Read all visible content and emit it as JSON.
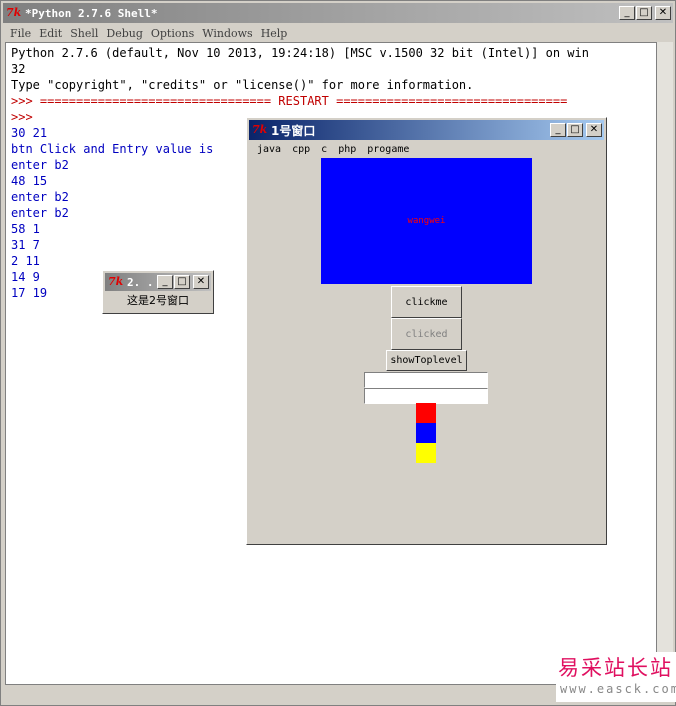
{
  "shell": {
    "title": "*Python 2.7.6 Shell*",
    "icon_text": "7k",
    "menu": [
      "File",
      "Edit",
      "Shell",
      "Debug",
      "Options",
      "Windows",
      "Help"
    ],
    "lines": [
      {
        "text": "Python 2.7.6 (default, Nov 10 2013, 19:24:18) [MSC v.1500 32 bit (Intel)] on win",
        "color": "blk"
      },
      {
        "text": "32",
        "color": "blk"
      },
      {
        "text": "Type \"copyright\", \"credits\" or \"license()\" for more information.",
        "color": "blk"
      },
      {
        "text": ">>> ================================ RESTART ================================",
        "color": "red"
      },
      {
        "text": ">>> ",
        "color": "red"
      },
      {
        "text": "30 21",
        "color": "blu"
      },
      {
        "text": "btn Click and Entry value is",
        "color": "blu"
      },
      {
        "text": "enter b2",
        "color": "blu"
      },
      {
        "text": "48 15",
        "color": "blu"
      },
      {
        "text": "enter b2",
        "color": "blu"
      },
      {
        "text": "enter b2",
        "color": "blu"
      },
      {
        "text": "58 1",
        "color": "blu"
      },
      {
        "text": "31 7",
        "color": "blu"
      },
      {
        "text": "2 11",
        "color": "blu"
      },
      {
        "text": "14 9",
        "color": "blu"
      },
      {
        "text": "17 19",
        "color": "blu"
      }
    ]
  },
  "window1": {
    "title": "1号窗口",
    "icon_text": "7k",
    "menu": [
      "java",
      "cpp",
      "c",
      "php",
      "progame"
    ],
    "canvas_text": "wangwei",
    "canvas_color": "#0000ff",
    "button_clickme": "clickme",
    "button_clicked": "clicked",
    "button_toplevel": "showToplevel",
    "entry1_value": "",
    "entry2_value": "",
    "swatches": [
      "#ff0000",
      "#0000ff",
      "#ffff00"
    ]
  },
  "window2": {
    "title": "2. . .",
    "icon_text": "7k",
    "label": "这是2号窗口"
  },
  "watermark": {
    "line1": "易采站长站",
    "line2": "www.easck.com"
  }
}
